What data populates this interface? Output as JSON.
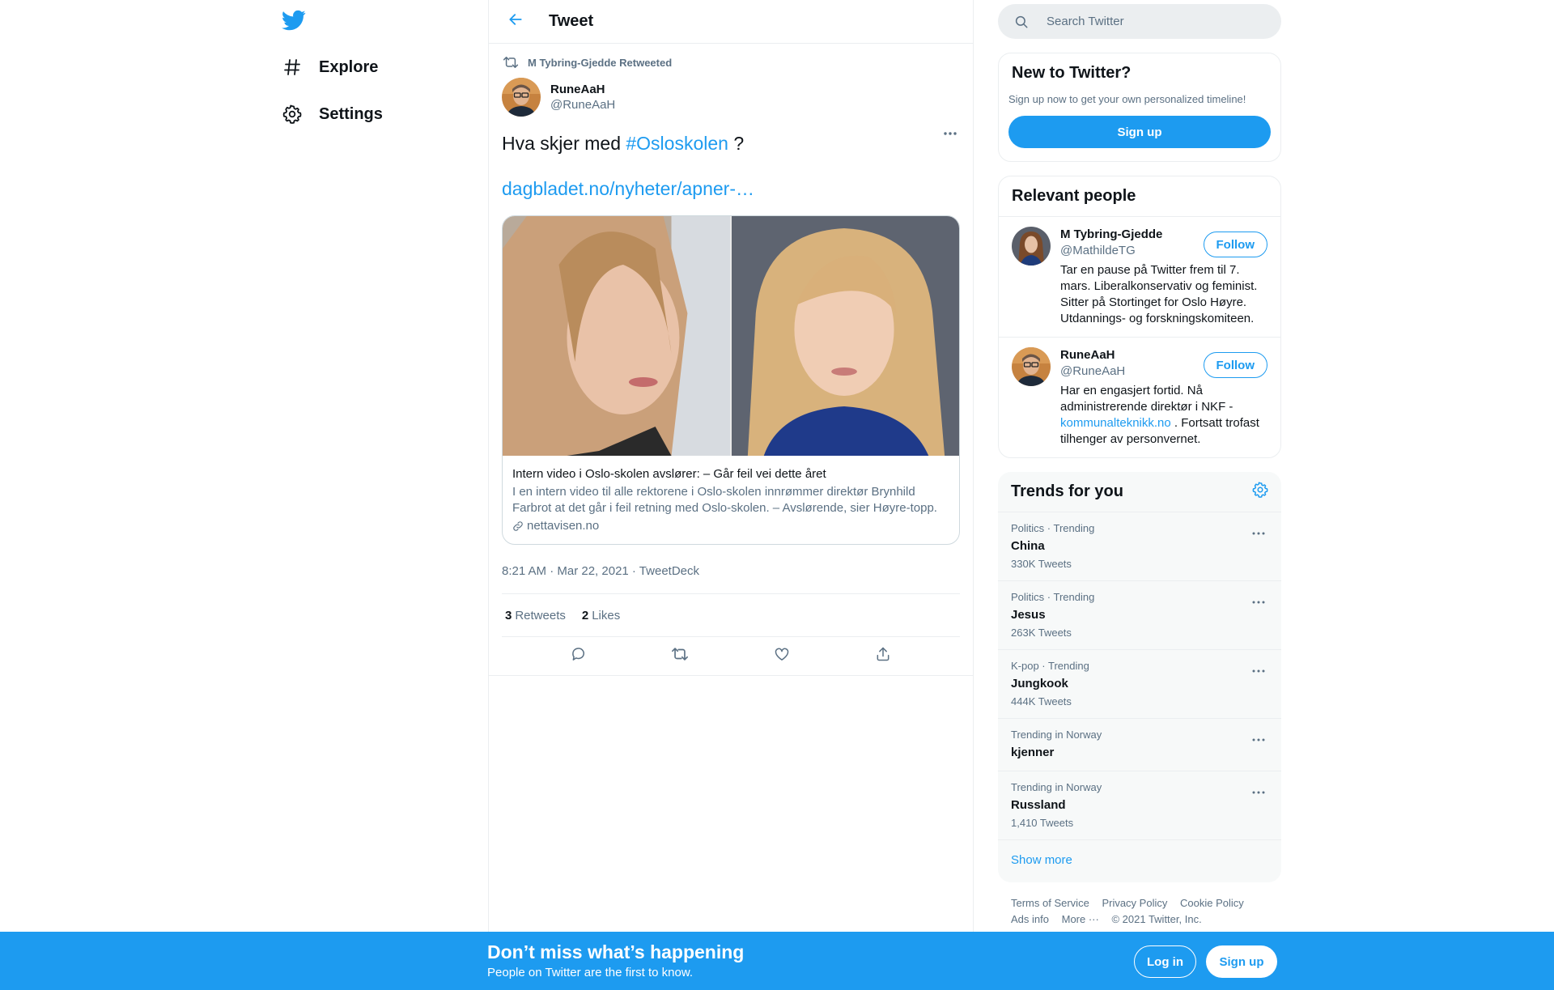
{
  "colors": {
    "accent": "#1d9bf0",
    "text": "#0f1419",
    "muted": "#5b7083",
    "border": "#ebeef0"
  },
  "nav": {
    "logo_icon": "twitter-bird-icon",
    "items": [
      {
        "label": "Explore",
        "icon": "hash-icon"
      },
      {
        "label": "Settings",
        "icon": "gear-icon"
      }
    ]
  },
  "header": {
    "title": "Tweet",
    "back_icon": "arrow-left-icon"
  },
  "tweet": {
    "retweeted_by": "M Tybring-Gjedde Retweeted",
    "author_name": "RuneAaH",
    "author_handle": "@RuneAaH",
    "text_before": "Hva skjer med",
    "hashtag": "#Osloskolen",
    "text_after": "?",
    "link": "dagbladet.no/nyheter/apner-…",
    "card": {
      "title": "Intern video i Oslo-skolen avslører: – Går feil vei dette året",
      "description": "I en intern video til alle rektorene i Oslo-skolen innrømmer direktør Brynhild Farbrot at det går i feil retning med Oslo-skolen. – Avslørende, sier Høyre-topp.",
      "domain": "nettavisen.no"
    },
    "time": "8:21 AM · Mar 22, 2021 · TweetDeck",
    "retweets_count": "3",
    "retweets_label": "Retweets",
    "likes_count": "2",
    "likes_label": "Likes"
  },
  "search": {
    "placeholder": "Search Twitter"
  },
  "new_to_twitter": {
    "title": "New to Twitter?",
    "subtitle": "Sign up now to get your own personalized timeline!",
    "button": "Sign up"
  },
  "relevant_people": {
    "title": "Relevant people",
    "people": [
      {
        "name": "M Tybring-Gjedde",
        "handle": "@MathildeTG",
        "bio": "Tar en pause på Twitter frem til 7. mars. Liberalkonservativ og feminist. Sitter på Stortinget for Oslo Høyre. Utdannings- og forskningskomiteen.",
        "follow": "Follow"
      },
      {
        "name": "RuneAaH",
        "handle": "@RuneAaH",
        "bio_before": "Har en engasjert fortid. Nå administrerende direktør i NKF -",
        "bio_link": "kommunalteknikk.no",
        "bio_after": ". Fortsatt trofast tilhenger av personvernet.",
        "follow": "Follow"
      }
    ]
  },
  "trends": {
    "title": "Trends for you",
    "items": [
      {
        "context": "Politics · Trending",
        "name": "China",
        "count": "330K Tweets"
      },
      {
        "context": "Politics · Trending",
        "name": "Jesus",
        "count": "263K Tweets"
      },
      {
        "context": "K-pop · Trending",
        "name": "Jungkook",
        "count": "444K Tweets"
      },
      {
        "context": "Trending in Norway",
        "name": "kjenner",
        "count": ""
      },
      {
        "context": "Trending in Norway",
        "name": "Russland",
        "count": "1,410 Tweets"
      }
    ],
    "show_more": "Show more"
  },
  "footer": {
    "links": [
      "Terms of Service",
      "Privacy Policy",
      "Cookie Policy",
      "Ads info",
      "More ···"
    ],
    "copyright": "© 2021 Twitter, Inc."
  },
  "bottom_bar": {
    "heading": "Don’t miss what’s happening",
    "sub": "People on Twitter are the first to know.",
    "login": "Log in",
    "signup": "Sign up"
  }
}
